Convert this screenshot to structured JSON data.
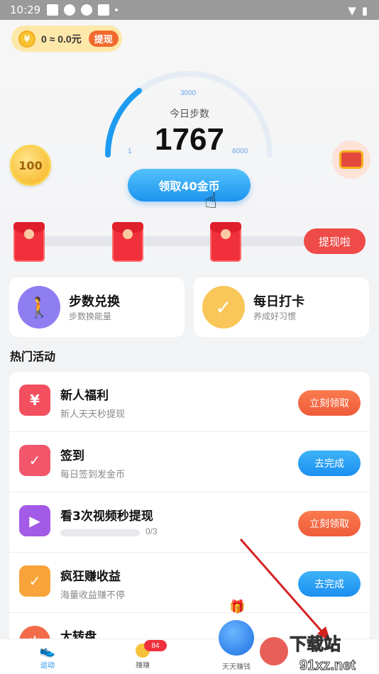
{
  "status": {
    "time": "10:29"
  },
  "coin": {
    "balance": "0 ≈ 0.0元",
    "withdraw": "提现",
    "icon": "yen-coin-icon"
  },
  "gauge": {
    "label": "今日步数",
    "steps": "1767",
    "tick_min": "1",
    "tick_mid": "3000",
    "tick_max": "6000",
    "progress": 0.29
  },
  "claim_button": "领取40金币",
  "coin100": "100",
  "progress_withdraw": "提现啦",
  "cards": [
    {
      "title": "步数兑换",
      "subtitle": "步数换能量",
      "icon": "walking-person-icon",
      "color": "#8f7df2"
    },
    {
      "title": "每日打卡",
      "subtitle": "养成好习惯",
      "icon": "calendar-check-icon",
      "color": "#f8c659"
    }
  ],
  "section_title": "热门活动",
  "activities": [
    {
      "title": "新人福利",
      "subtitle": "新人天天秒提现",
      "button": "立刻领取",
      "style": "orange",
      "icon": "red-envelope-icon",
      "color": "#f24f5f"
    },
    {
      "title": "签到",
      "subtitle": "每日签到发金币",
      "button": "去完成",
      "style": "blue",
      "icon": "calendar-check-icon",
      "color": "#f2566a"
    },
    {
      "title": "看3次视频秒提现",
      "subtitle": "",
      "progress_text": "0/3",
      "progress": 0,
      "button": "立刻领取",
      "style": "orange",
      "icon": "video-bag-icon",
      "color": "#a35ae6"
    },
    {
      "title": "疯狂赚收益",
      "subtitle": "海量收益赚不停",
      "button": "去完成",
      "style": "blue",
      "icon": "checkbox-icon",
      "color": "#f9a43a"
    },
    {
      "title": "大转盘",
      "subtitle": "",
      "button": "",
      "style": "",
      "icon": "wheel-icon",
      "color": "#f36b4a"
    }
  ],
  "nav": [
    {
      "label": "运动",
      "icon": "shoe-icon",
      "active": true
    },
    {
      "label": "赚赚",
      "icon": "coin-icon",
      "active": false
    },
    {
      "label": "天天赚钱",
      "icon": "ball-icon",
      "active": false
    }
  ],
  "nav_badge": "84",
  "watermark": {
    "brand": "下载站",
    "domain": "91xz.net"
  }
}
